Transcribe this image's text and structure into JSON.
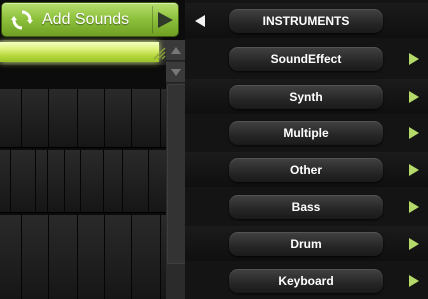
{
  "toolbar": {
    "add_sounds_label": "Add Sounds",
    "accent_color": "#8fc33e"
  },
  "progress": {
    "value": 0.96
  },
  "instruments": {
    "header": "INSTRUMENTS",
    "items": [
      {
        "label": "SoundEffect"
      },
      {
        "label": "Synth"
      },
      {
        "label": "Multiple"
      },
      {
        "label": "Other"
      },
      {
        "label": "Bass"
      },
      {
        "label": "Drum"
      },
      {
        "label": "Keyboard"
      }
    ],
    "arrow_color": "#b5da6a"
  },
  "icons": {
    "refresh": "refresh-icon",
    "play": "play-arrow-icon",
    "back": "back-arrow-icon",
    "forward": "arrow-right-icon"
  }
}
